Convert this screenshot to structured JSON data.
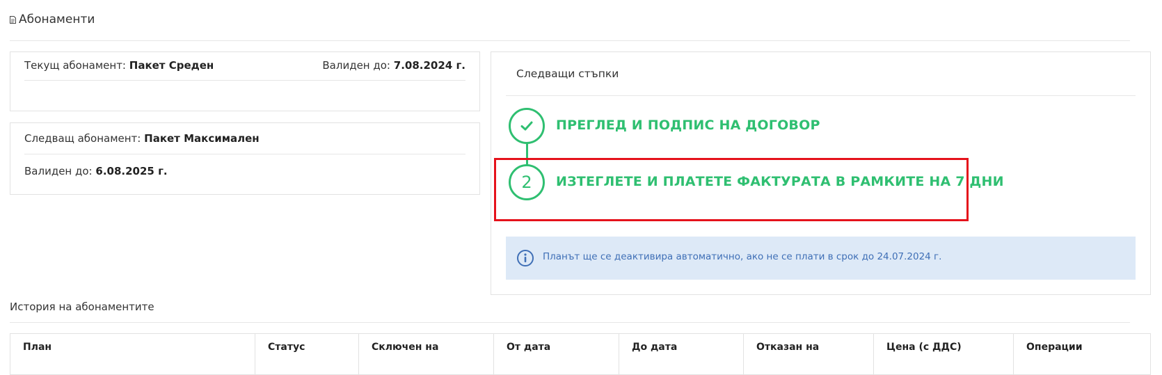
{
  "header": {
    "title": "Абонаменти",
    "icon": "document-icon"
  },
  "current_subscription": {
    "label": "Текущ абонамент:",
    "plan": "Пакет Среден",
    "valid_label": "Валиден до:",
    "valid_date": "7.08.2024 г."
  },
  "next_subscription": {
    "label": "Следващ абонамент:",
    "plan": "Пакет Максимален",
    "valid_label": "Валиден до:",
    "valid_date": "6.08.2025 г."
  },
  "next_steps": {
    "title": "Следващи стъпки",
    "steps": [
      {
        "marker": "✔",
        "label": "ПРЕГЛЕД И ПОДПИС НА ДОГОВОР",
        "status": "done"
      },
      {
        "marker": "2",
        "label": "ИЗТЕГЛЕТЕ И ПЛАТЕТЕ ФАКТУРАТА В РАМКИТЕ НА 7 ДНИ",
        "status": "current"
      }
    ],
    "alert": "Планът ще се деактивира автоматично, ако не се плати в срок до 24.07.2024 г.",
    "accent_color": "#2fbf71",
    "highlight_color": "#e5121b"
  },
  "history": {
    "title": "История на абонаментите",
    "columns": [
      "План",
      "Статус",
      "Сключен на",
      "От дата",
      "До дата",
      "Отказан на",
      "Цена (с ДДС)",
      "Операции"
    ]
  }
}
